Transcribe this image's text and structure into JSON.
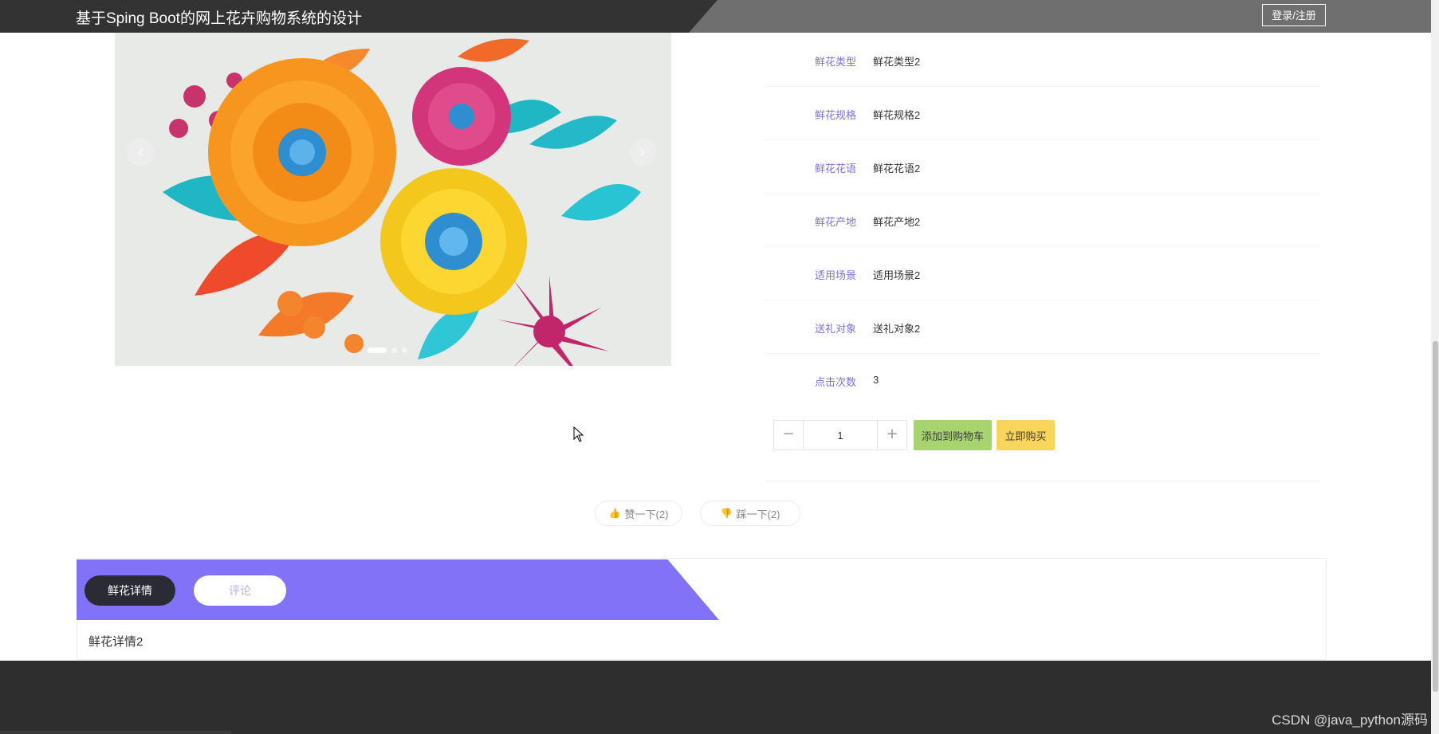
{
  "header": {
    "site_title": "基于Sping Boot的网上花卉购物系统的设计",
    "login_label": "登录/注册"
  },
  "carousel": {
    "prev_icon": "chevron-left-icon",
    "next_icon": "chevron-right-icon",
    "prev_symbol": "‹",
    "next_symbol": "›",
    "slide_count": 3,
    "active_slide": 1
  },
  "details": {
    "fields": [
      {
        "label": "鲜花类型",
        "value": "鲜花类型2"
      },
      {
        "label": "鲜花规格",
        "value": "鲜花规格2"
      },
      {
        "label": "鲜花花语",
        "value": "鲜花花语2"
      },
      {
        "label": "鲜花产地",
        "value": "鲜花产地2"
      },
      {
        "label": "适用场景",
        "value": "适用场景2"
      },
      {
        "label": "送礼对象",
        "value": "送礼对象2"
      },
      {
        "label": "点击次数",
        "value": "3"
      }
    ]
  },
  "purchase": {
    "minus_symbol": "−",
    "plus_symbol": "+",
    "quantity": "1",
    "add_to_cart_label": "添加到购物车",
    "buy_now_label": "立即购买"
  },
  "votes": {
    "like_label": "赞一下(2)",
    "dislike_label": "踩一下(2)",
    "like_icon": "thumbs-up-icon",
    "dislike_icon": "thumbs-down-icon",
    "like_symbol": "👍",
    "dislike_symbol": "👎"
  },
  "tabs": {
    "items": [
      {
        "label": "鲜花详情",
        "active": true
      },
      {
        "label": "评论",
        "active": false
      }
    ],
    "content": "鲜花详情2"
  },
  "watermark": "CSDN @java_python源码",
  "colors": {
    "accent": "#8272f7",
    "label_purple": "#7f6fdd",
    "cart_green": "#a8d46f",
    "buy_yellow": "#f9d65b",
    "header_dark": "#333333",
    "footer_dark": "#2e2e2e"
  }
}
